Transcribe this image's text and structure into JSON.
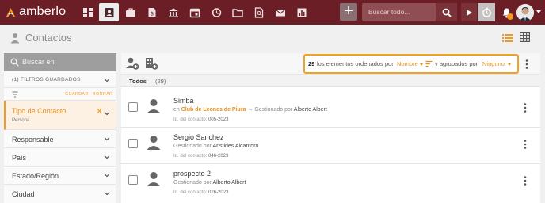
{
  "app": {
    "name": "amberlo"
  },
  "topbar": {
    "nav_icons": [
      "dashboard-icon",
      "contacts-icon",
      "briefcase-icon",
      "invoice-icon",
      "bank-icon",
      "calendar-icon",
      "history-icon",
      "folder-icon",
      "document-search-icon",
      "mail-icon",
      "chart-icon"
    ],
    "search_placeholder": "Buscar todo...",
    "accent": "#6b1e26"
  },
  "page": {
    "title": "Contactos"
  },
  "sidebar": {
    "search_placeholder": "Buscar en",
    "filters_saved": "(1) FILTROS GUARDADOS",
    "save_label": "GUARDAR",
    "clear_label": "BORRAR",
    "active_filter": {
      "label": "Tipo de Contacto",
      "value": "Persona"
    },
    "filters": [
      {
        "label": "Responsable"
      },
      {
        "label": "País"
      },
      {
        "label": "Estado/Región"
      },
      {
        "label": "Ciudad"
      }
    ]
  },
  "toolbar": {
    "count": "29",
    "sorted_text": "los elementos ordenados por",
    "sort_value": "Nombre",
    "grouped_text": "y agrupados por",
    "group_value": "Ninguno"
  },
  "group": {
    "title": "Todos",
    "count": "(29)"
  },
  "contacts": [
    {
      "name": "Simba",
      "prefix": "en",
      "org": "Club de Leones de Piura",
      "arrow": "→",
      "managed_label": "Gestionado por",
      "manager": "Alberto Albert",
      "id_label": "Id. del contacto:",
      "id": "005-2023"
    },
    {
      "name": "Sergio Sanchez",
      "managed_label": "Gestionado por",
      "manager": "Aristides Alcantoro",
      "id_label": "Id. del contacto:",
      "id": "046-2023"
    },
    {
      "name": "prospecto 2",
      "managed_label": "Gestionado por",
      "manager": "Alberto Albert",
      "id_label": "Id. del contacto:",
      "id": "026-2023"
    }
  ]
}
